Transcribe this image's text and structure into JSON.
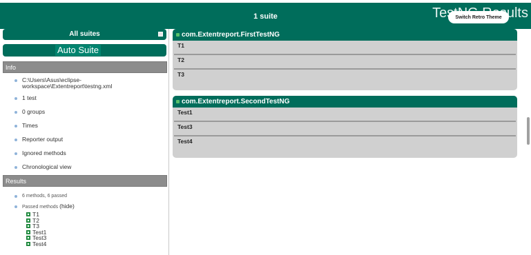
{
  "header": {
    "suite_count": "1 suite",
    "background_title": "TestNG Results",
    "retro_button": "Switch Retro Theme"
  },
  "nav": {
    "all_suites": "All suites",
    "suite_name": "Auto Suite"
  },
  "info": {
    "heading": "Info",
    "items": [
      "C:\\Users\\Asus\\eclipse-workspace\\Extentreport\\testng.xml",
      "1 test",
      "0 groups",
      "Times",
      "Reporter output",
      "Ignored methods",
      "Chronological view"
    ]
  },
  "results": {
    "heading": "Results",
    "summary": "6 methods, 6 passed",
    "passed_label": "Passed methods",
    "hide_label": "(hide)",
    "methods": [
      "T1",
      "T2",
      "T3",
      "Test1",
      "Test3",
      "Test4"
    ]
  },
  "classes": [
    {
      "name": "com.Extentreport.FirstTestNG",
      "methods": [
        "T1",
        "T2",
        "T3"
      ]
    },
    {
      "name": "com.Extentreport.SecondTestNG",
      "methods": [
        "Test1",
        "Test3",
        "Test4"
      ]
    }
  ],
  "colors": {
    "accent": "#006d5b",
    "section_header": "#8c8c8c",
    "panel_bg": "#d0d0d0",
    "pass": "#2ea44f"
  }
}
